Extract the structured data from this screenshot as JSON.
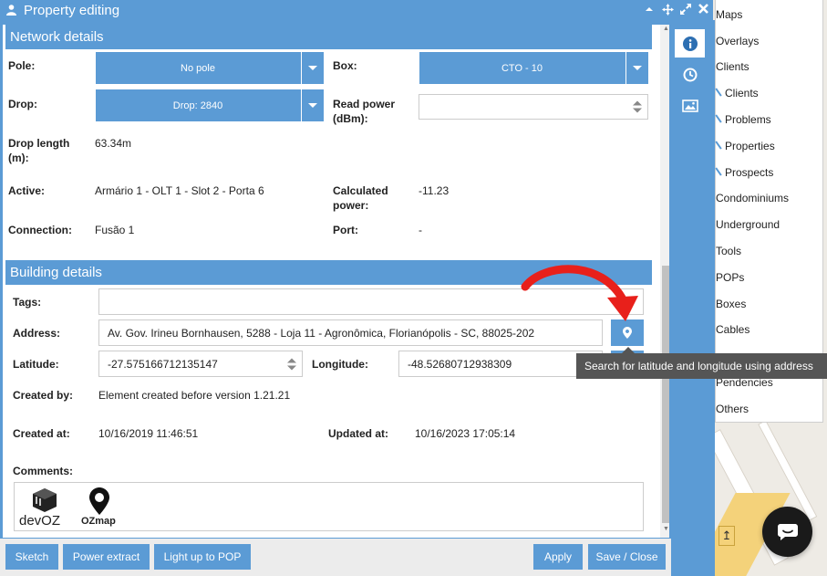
{
  "window": {
    "title": "Property editing"
  },
  "network": {
    "header": "Network details",
    "pole_label": "Pole:",
    "pole_value": "No pole",
    "box_label": "Box:",
    "box_value": "CTO - 10",
    "drop_label": "Drop:",
    "drop_value": "Drop: 2840",
    "read_power_label": "Read power (dBm):",
    "read_power_value": "",
    "drop_length_label": "Drop length (m):",
    "drop_length_value": "63.34m",
    "active_label": "Active:",
    "active_value": "Armário 1 - OLT 1 - Slot 2 - Porta 6",
    "calc_power_label": "Calculated power:",
    "calc_power_value": "-11.23",
    "connection_label": "Connection:",
    "connection_value": "Fusão 1",
    "port_label": "Port:",
    "port_value": "-"
  },
  "building": {
    "header": "Building details",
    "tags_label": "Tags:",
    "tags_value": "",
    "address_label": "Address:",
    "address_value": "Av. Gov. Irineu Bornhausen, 5288 - Loja 11 - Agronômica, Florianópolis - SC, 88025-202",
    "latitude_label": "Latitude:",
    "latitude_value": "-27.575166712135147",
    "longitude_label": "Longitude:",
    "longitude_value": "-48.52680712938309",
    "created_by_label": "Created by:",
    "created_by_value": "Element created before version 1.21.21",
    "created_at_label": "Created at:",
    "created_at_value": "10/16/2019 11:46:51",
    "updated_at_label": "Updated at:",
    "updated_at_value": "10/16/2023 17:05:14",
    "comments_label": "Comments:",
    "logo_devoz": "devOZ",
    "logo_ozmap": "OZmap"
  },
  "tooltip": "Search for latitude and longitude using address",
  "footer": {
    "sketch": "Sketch",
    "power_extract": "Power extract",
    "light_up": "Light up to POP",
    "apply": "Apply",
    "save_close": "Save / Close"
  },
  "menu": {
    "items": [
      "Maps",
      "Overlays",
      "Clients",
      "Clients",
      "Problems",
      "Properties",
      "Prospects",
      "Condominiums",
      "Underground",
      "Tools",
      "POPs",
      "Boxes",
      "Cables",
      "Pendencies",
      "Others"
    ]
  },
  "colors": {
    "accent": "#5b9bd5",
    "arrow": "#e8201b"
  }
}
